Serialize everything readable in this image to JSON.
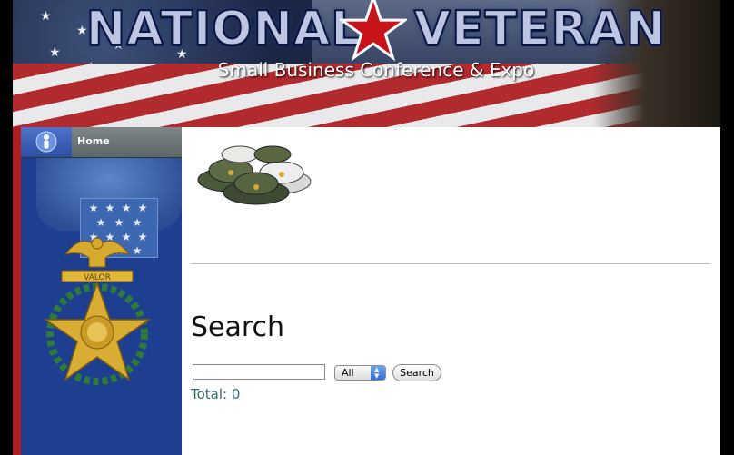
{
  "banner": {
    "title_part1": "NATIONAL",
    "title_part2": "VETERAN",
    "subtitle": "Small Business Conference & Expo"
  },
  "sidebar": {
    "nav_items": [
      {
        "label": "Home",
        "icon": "person-icon"
      }
    ],
    "medal_text": "VALOR"
  },
  "main": {
    "page_title": "Search",
    "search": {
      "value": "",
      "placeholder": "",
      "scope_selected": "All",
      "button_label": "Search"
    },
    "total_label": "Total:",
    "total_value": "0"
  },
  "colors": {
    "sidebar_blue": "#1e3f8f",
    "sidebar_red": "#b11e22",
    "total_text": "#2f6d6d"
  }
}
